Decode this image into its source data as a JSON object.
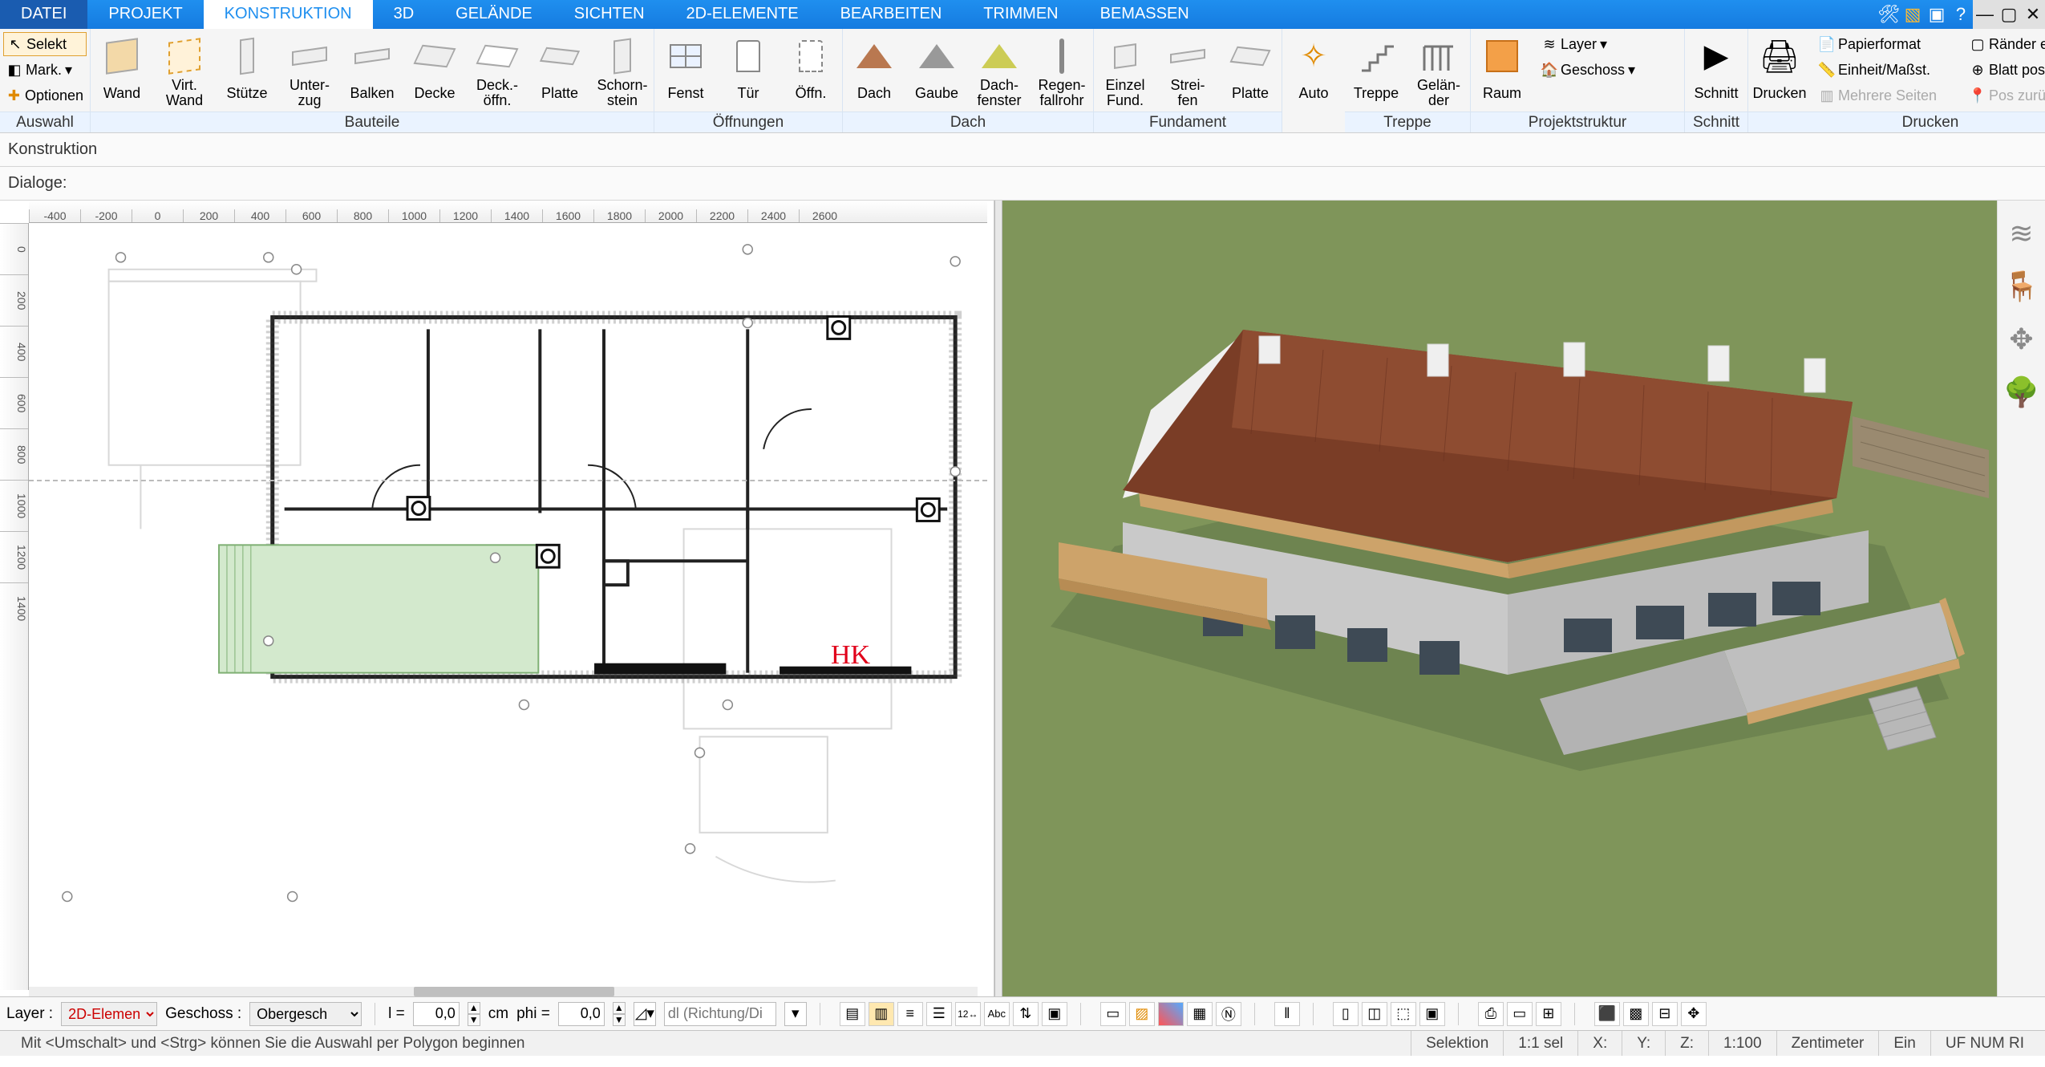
{
  "menu": {
    "datei": "DATEI",
    "projekt": "PROJEKT",
    "konstruktion": "KONSTRUKTION",
    "d3": "3D",
    "gelaende": "GELÄNDE",
    "sichten": "SICHTEN",
    "elemente2d": "2D-ELEMENTE",
    "bearbeiten": "BEARBEITEN",
    "trimmen": "TRIMMEN",
    "bemassen": "BEMASSEN"
  },
  "ribbon": {
    "auswahl": {
      "selekt": "Selekt",
      "mark": "Mark.",
      "optionen": "Optionen",
      "label": "Auswahl"
    },
    "bauteile": {
      "wand": "Wand",
      "virtwand": "Virt.\nWand",
      "stuetze": "Stütze",
      "unterzug": "Unter-\nzug",
      "balken": "Balken",
      "decke": "Decke",
      "deckoffn": "Deck.-\nöffn.",
      "platte": "Platte",
      "schornstein": "Schorn-\nstein",
      "label": "Bauteile"
    },
    "oeffnungen": {
      "fenst": "Fenst",
      "tuer": "Tür",
      "oeffn": "Öffn.",
      "label": "Öffnungen"
    },
    "dach": {
      "dach": "Dach",
      "gaube": "Gaube",
      "dachfenster": "Dach-\nfenster",
      "regen": "Regen-\nfallrohr",
      "label": "Dach"
    },
    "fundament": {
      "einzel": "Einzel\nFund.",
      "streifen": "Strei-\nfen",
      "platte": "Platte",
      "label": "Fundament"
    },
    "treppe_sec": {
      "auto": "Auto",
      "treppe": "Treppe",
      "gelaender": "Gelän-\nder",
      "label": "Treppe"
    },
    "projektstruktur": {
      "raum": "Raum",
      "layer": "Layer",
      "geschoss": "Geschoss",
      "label": "Projektstruktur"
    },
    "schnitt": {
      "schnitt": "Schnitt",
      "label": "Schnitt"
    },
    "drucken": {
      "drucken": "Drucken",
      "papierformat": "Papierformat",
      "einheit": "Einheit/Maßst.",
      "mehrere": "Mehrere Seiten",
      "raender": "Ränder einblend.",
      "blattpos": "Blatt position.",
      "posrueck": "Pos zurücksetz.",
      "label": "Drucken"
    }
  },
  "subbar": {
    "konstruktion": "Konstruktion",
    "dialoge": "Dialoge:"
  },
  "ruler_h": [
    "-400",
    "-200",
    "0",
    "200",
    "400",
    "600",
    "800",
    "1000",
    "1200",
    "1400",
    "1600",
    "1800",
    "2000",
    "2200",
    "2400",
    "2600"
  ],
  "ruler_v": [
    "0",
    "200",
    "400",
    "600",
    "800",
    "1000",
    "1200",
    "1400"
  ],
  "plan": {
    "hk": "HK"
  },
  "bottom": {
    "layer_label": "Layer :",
    "layer_value": "2D-Elemen",
    "geschoss_label": "Geschoss :",
    "geschoss_value": "Obergesch",
    "l_label": "l =",
    "l_value": "0,0",
    "cm": "cm",
    "phi_label": "phi =",
    "phi_value": "0,0",
    "dl_placeholder": "dl (Richtung/Di"
  },
  "status": {
    "hint": "Mit <Umschalt> und <Strg> können Sie die Auswahl per Polygon beginnen",
    "selektion": "Selektion",
    "sel11": "1:1 sel",
    "X": "X:",
    "Y": "Y:",
    "Z": "Z:",
    "scale": "1:100",
    "unit": "Zentimeter",
    "ein": "Ein",
    "ufnum": "UF NUM RI"
  }
}
